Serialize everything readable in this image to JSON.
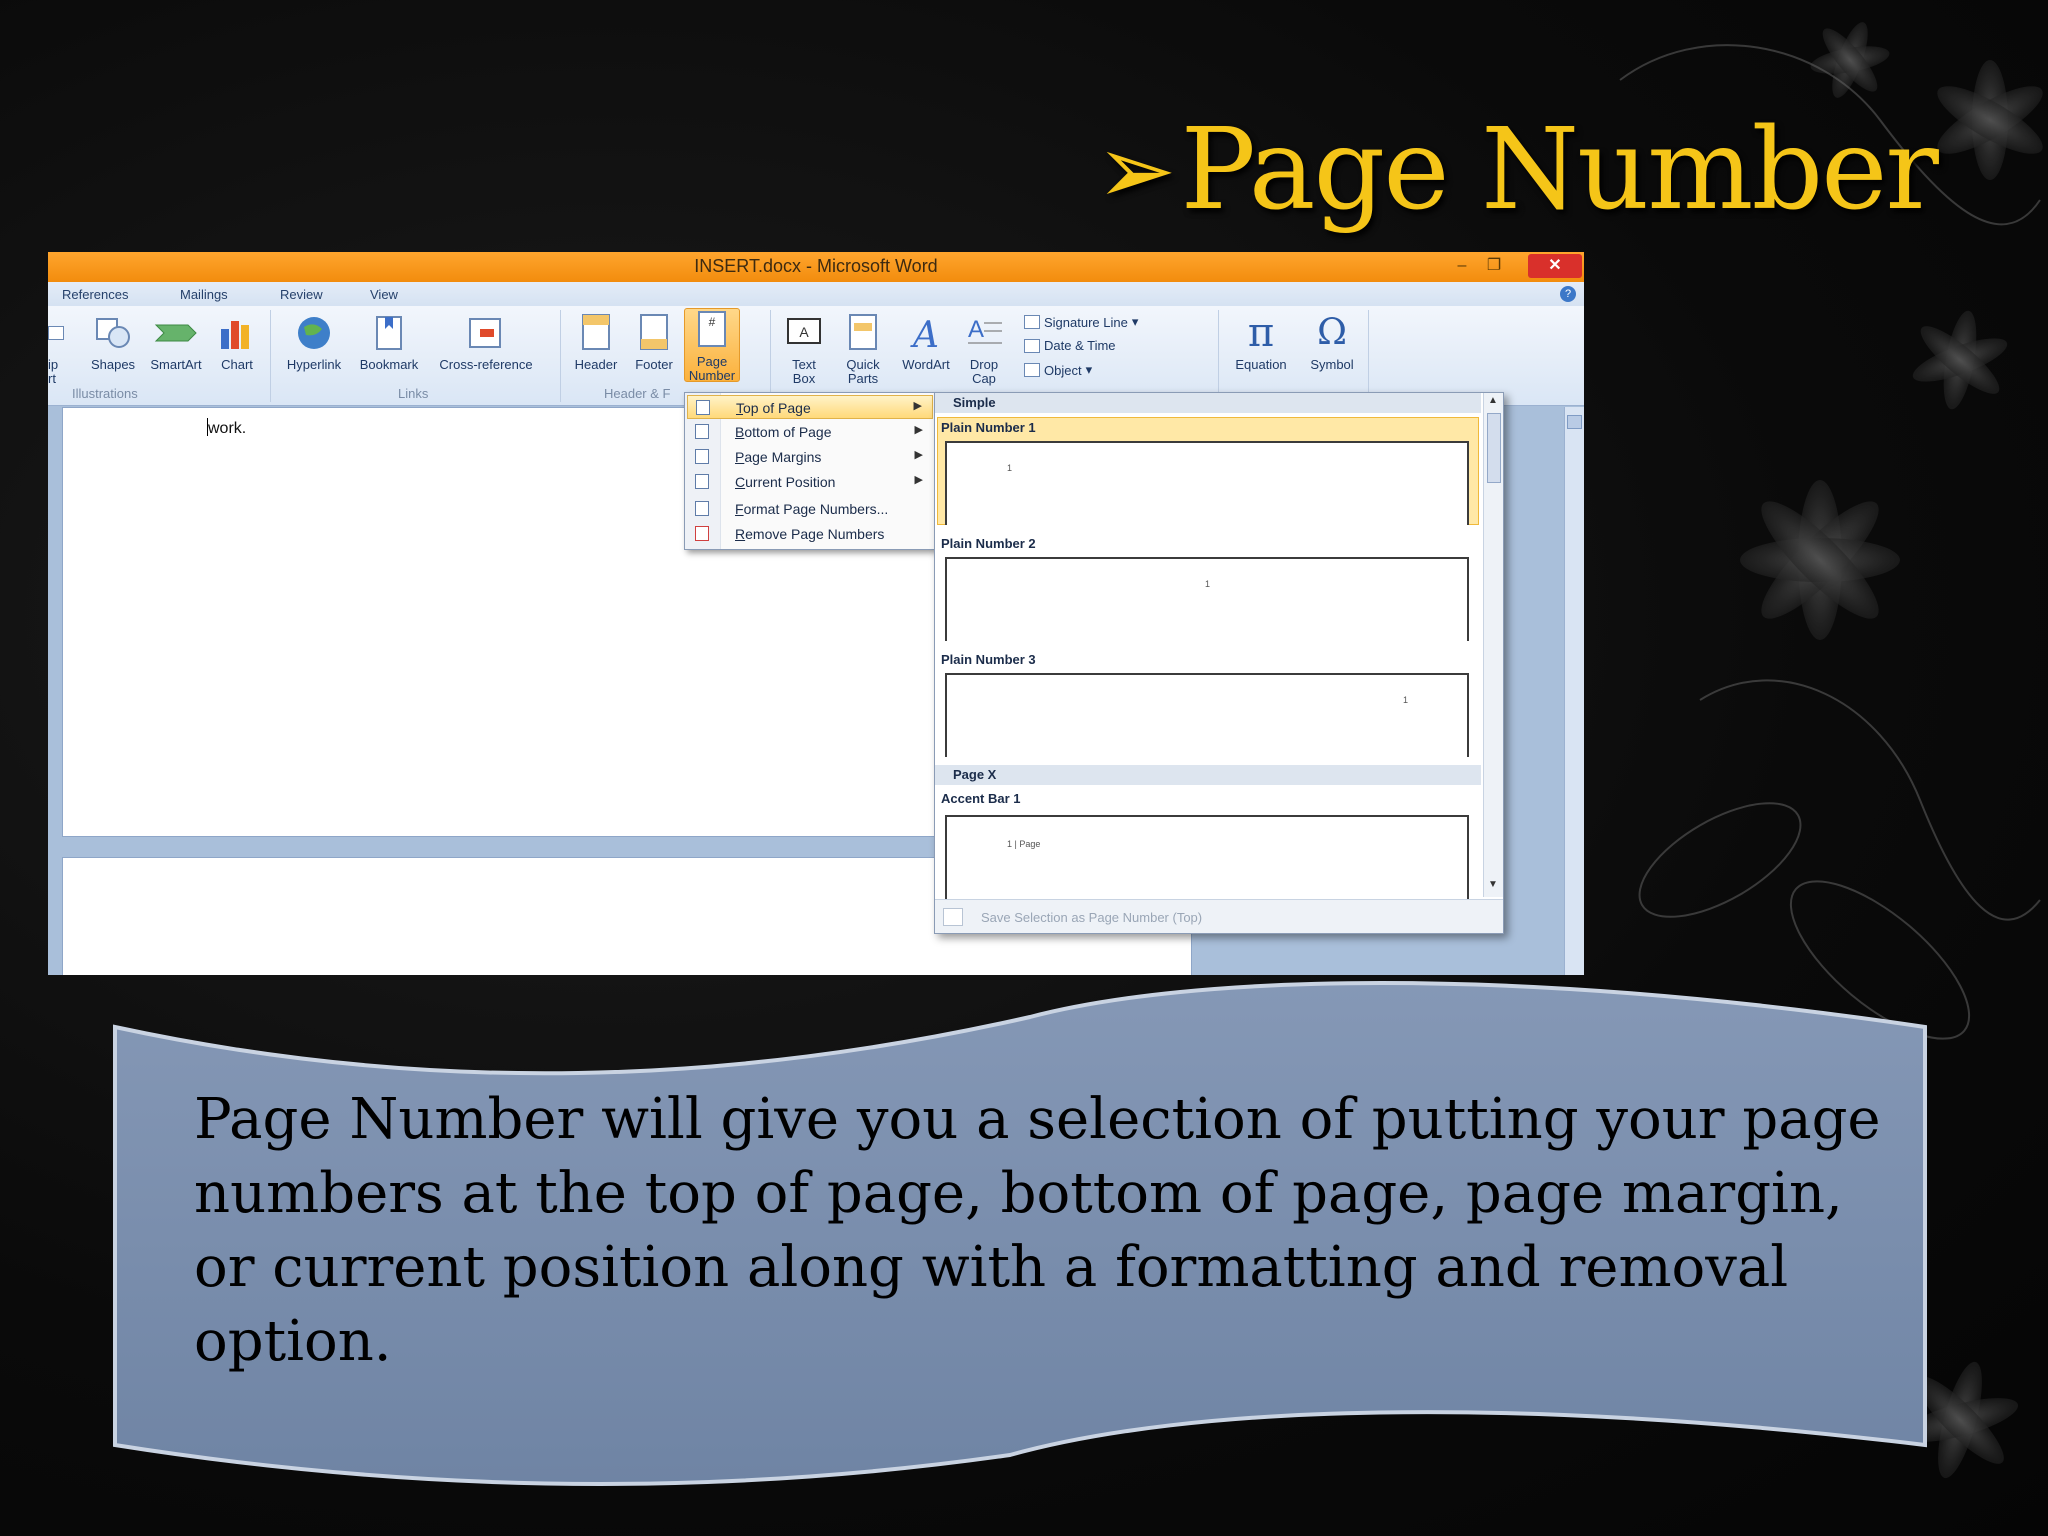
{
  "slide": {
    "title": "Page Number",
    "title_arrow": "➢",
    "description": "Page Number will give you a selection of putting your page numbers at the top of page, bottom of page, page margin, or current position along with a formatting and removal option."
  },
  "window": {
    "title": "INSERT.docx - Microsoft Word",
    "minimize": "–",
    "restore": "❐",
    "close": "✕"
  },
  "tabs": [
    "References",
    "Mailings",
    "Review",
    "View"
  ],
  "ribbon": {
    "clip_art_partial": "ip\nrt",
    "shapes": "Shapes",
    "smartart": "SmartArt",
    "chart": "Chart",
    "illustrations_group": "Illustrations",
    "hyperlink": "Hyperlink",
    "bookmark": "Bookmark",
    "cross_reference": "Cross-reference",
    "links_group": "Links",
    "header": "Header",
    "footer": "Footer",
    "page_number_l1": "Page",
    "page_number_l2": "Number",
    "header_footer_group": "Header & F",
    "text_box_l1": "Text",
    "text_box_l2": "Box",
    "quick_parts_l1": "Quick",
    "quick_parts_l2": "Parts",
    "wordart": "WordArt",
    "drop_cap_l1": "Drop",
    "drop_cap_l2": "Cap",
    "signature_line": "Signature Line",
    "date_time": "Date & Time",
    "object": "Object",
    "equation": "Equation",
    "symbol": "Symbol"
  },
  "document": {
    "text": "work."
  },
  "menu": {
    "items": [
      {
        "label": "Top of Page",
        "has_submenu": true,
        "highlighted": true
      },
      {
        "label": "Bottom of Page",
        "has_submenu": true
      },
      {
        "label": "Page Margins",
        "has_submenu": true
      },
      {
        "label": "Current Position",
        "has_submenu": true
      },
      {
        "label": "Format Page Numbers...",
        "has_submenu": false
      },
      {
        "label": "Remove Page Numbers",
        "has_submenu": false
      }
    ]
  },
  "gallery": {
    "section_simple": "Simple",
    "items": [
      {
        "label": "Plain Number 1",
        "selected": true
      },
      {
        "label": "Plain Number 2"
      },
      {
        "label": "Plain Number 3"
      }
    ],
    "section_pagex": "Page X",
    "accent_bar": "Accent Bar 1",
    "accent_preview": "1 | Page",
    "footer_action": "Save Selection as Page Number (Top)"
  },
  "colors": {
    "title_gold": "#f5c518",
    "office_orange": "#f7941d",
    "ribbon_blue": "#dae6f5",
    "banner_blue": "#7a8fae"
  }
}
